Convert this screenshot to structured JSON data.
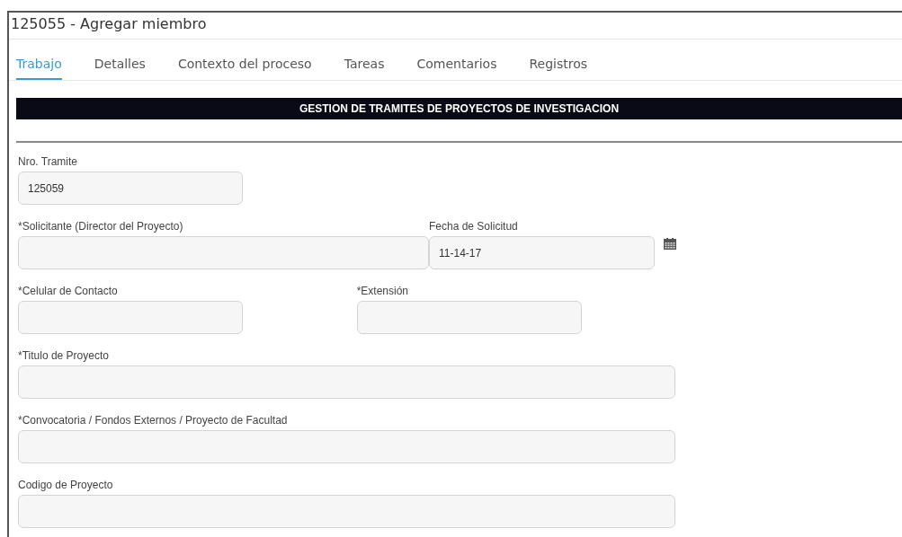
{
  "window": {
    "title": "125055 - Agregar miembro"
  },
  "tabs": [
    {
      "label": "Trabajo",
      "selected": true
    },
    {
      "label": "Detalles",
      "selected": false
    },
    {
      "label": "Contexto del proceso",
      "selected": false
    },
    {
      "label": "Tareas",
      "selected": false
    },
    {
      "label": "Comentarios",
      "selected": false
    },
    {
      "label": "Registros",
      "selected": false
    }
  ],
  "section": {
    "title": "GESTION DE TRAMITES DE PROYECTOS DE INVESTIGACION"
  },
  "form": {
    "rows": [
      [
        {
          "label": "Nro. Tramite",
          "value": "125059",
          "kind": "short"
        }
      ],
      [
        {
          "label": "*Solicitante (Director del Proyecto)",
          "kind": "medium"
        },
        {
          "label": "Fecha de Solicitud",
          "value": "11-14-17",
          "kind": "date"
        }
      ],
      [
        {
          "label": "*Celular de Contacto",
          "kind": "short"
        },
        {
          "label": "*Extensión",
          "kind": "short"
        }
      ],
      [
        {
          "label": "*Titulo de Proyecto",
          "kind": "long"
        }
      ],
      [
        {
          "label": "*Convocatoria / Fondos Externos / Proyecto de Facultad",
          "kind": "long"
        }
      ],
      [
        {
          "label": "Codigo de Proyecto",
          "kind": "long"
        }
      ]
    ]
  }
}
